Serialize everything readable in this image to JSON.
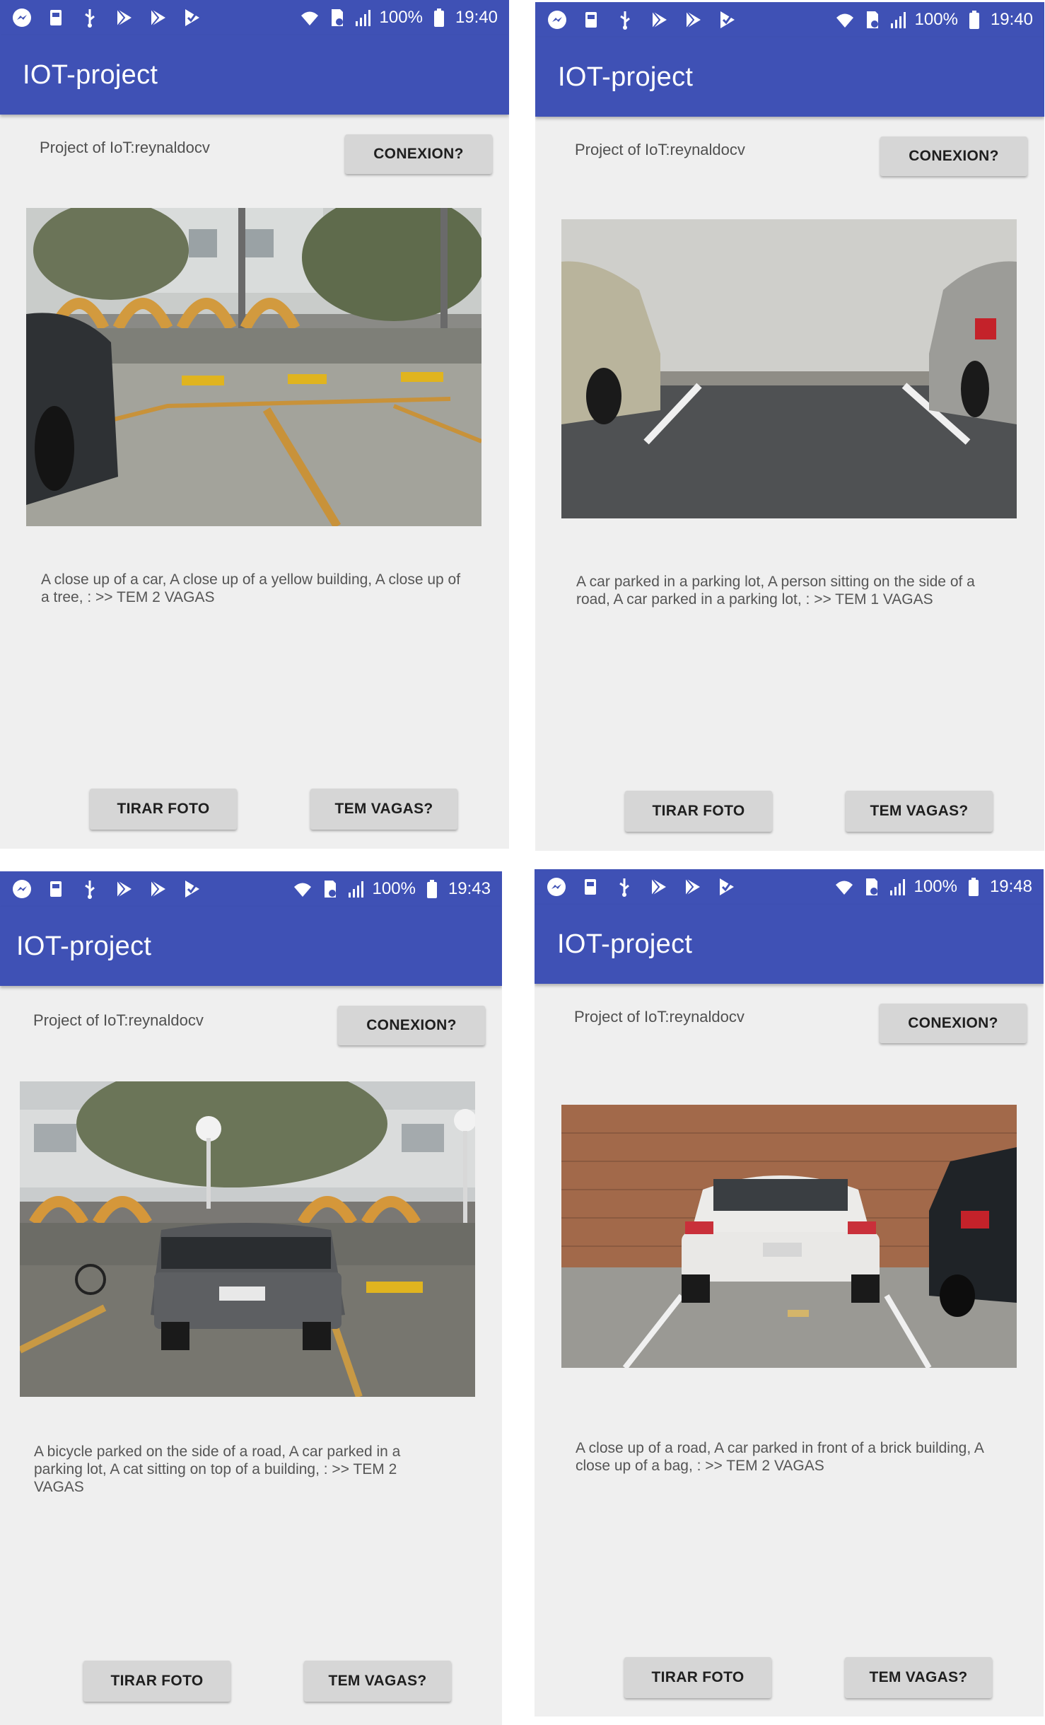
{
  "status_bar": {
    "battery": "100%",
    "times": [
      "19:40",
      "19:40",
      "19:43",
      "19:48"
    ]
  },
  "app": {
    "title": "IOT-project",
    "project_label": "Project of IoT:reynaldocv",
    "conexion_label": "CONEXION?",
    "tirar_foto_label": "TIRAR FOTO",
    "tem_vagas_label": "TEM VAGAS?"
  },
  "screens": [
    {
      "caption": "A close up of a car, A close up of a yellow building, A close up of a tree,  : >> TEM 2 VAGAS"
    },
    {
      "caption": "A car parked in a parking lot, A person sitting on the side of a road, A car parked in a parking lot,  : >> TEM 1 VAGAS"
    },
    {
      "caption": "A bicycle parked on the side of a road, A car parked in a parking lot, A cat sitting on top of a building,  : >> TEM 2 VAGAS"
    },
    {
      "caption": "A close up of a road, A car parked in front of a brick building, A close up of a bag,  : >> TEM 2 VAGAS"
    }
  ],
  "icons": [
    "messenger-icon",
    "sd-card-icon",
    "usb-icon",
    "play-store-icon",
    "play-store-icon",
    "play-check-icon",
    "wifi-icon",
    "sim-off-icon",
    "signal-icon",
    "battery-icon"
  ],
  "colors": {
    "primary": "#3f51b5",
    "background": "#efefef",
    "button": "#d6d6d6"
  }
}
